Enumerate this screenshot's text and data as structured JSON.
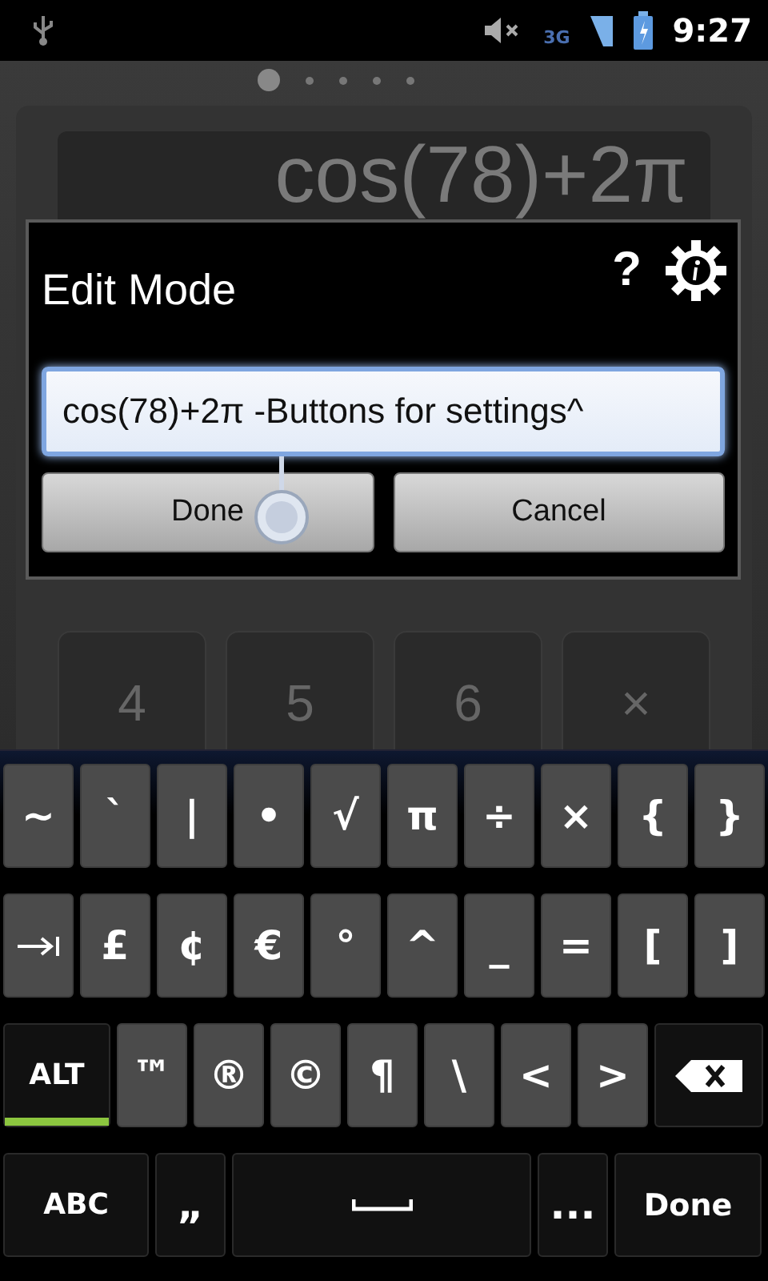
{
  "status_bar": {
    "network": "3G",
    "time": "9:27"
  },
  "pager": [
    {
      "selected": true
    },
    {
      "selected": false
    },
    {
      "selected": false
    },
    {
      "selected": false
    },
    {
      "selected": false
    }
  ],
  "calculator": {
    "display": "cos(78)+2π",
    "keys": [
      "4",
      "5",
      "6",
      "×"
    ]
  },
  "dialog": {
    "title": "Edit Mode",
    "help": "?",
    "field_value": "cos(78)+2π -Buttons for settings^",
    "buttons": [
      "Done",
      "Cancel"
    ]
  },
  "keyboard": {
    "row_1": [
      {
        "kind": "char",
        "label": "~"
      },
      {
        "kind": "char",
        "label": "`"
      },
      {
        "kind": "char",
        "label": "|"
      },
      {
        "kind": "char",
        "label": "•"
      },
      {
        "kind": "char",
        "label": "√"
      },
      {
        "kind": "char",
        "label": "π"
      },
      {
        "kind": "char",
        "label": "÷"
      },
      {
        "kind": "char",
        "label": "×"
      },
      {
        "kind": "char",
        "label": "{"
      },
      {
        "kind": "char",
        "label": "}"
      }
    ],
    "row_2": [
      {
        "kind": "tab"
      },
      {
        "kind": "char",
        "label": "£"
      },
      {
        "kind": "char",
        "label": "¢"
      },
      {
        "kind": "char",
        "label": "€"
      },
      {
        "kind": "char",
        "label": "°"
      },
      {
        "kind": "char",
        "label": "^"
      },
      {
        "kind": "char",
        "label": "_"
      },
      {
        "kind": "char",
        "label": "="
      },
      {
        "kind": "char",
        "label": "["
      },
      {
        "kind": "char",
        "label": "]"
      }
    ],
    "row_3": [
      {
        "kind": "alt",
        "label": "ALT",
        "on": true
      },
      {
        "kind": "char",
        "label": "™"
      },
      {
        "kind": "char",
        "label": "®"
      },
      {
        "kind": "char",
        "label": "©"
      },
      {
        "kind": "char",
        "label": "¶"
      },
      {
        "kind": "char",
        "label": "\\"
      },
      {
        "kind": "char",
        "label": "<"
      },
      {
        "kind": "char",
        "label": ">"
      },
      {
        "kind": "backspace"
      }
    ],
    "row_4": [
      {
        "kind": "mode",
        "label": "ABC"
      },
      {
        "kind": "dark",
        "label": "„"
      },
      {
        "kind": "space"
      },
      {
        "kind": "dark",
        "label": "..."
      },
      {
        "kind": "action",
        "label": "Done"
      }
    ]
  }
}
